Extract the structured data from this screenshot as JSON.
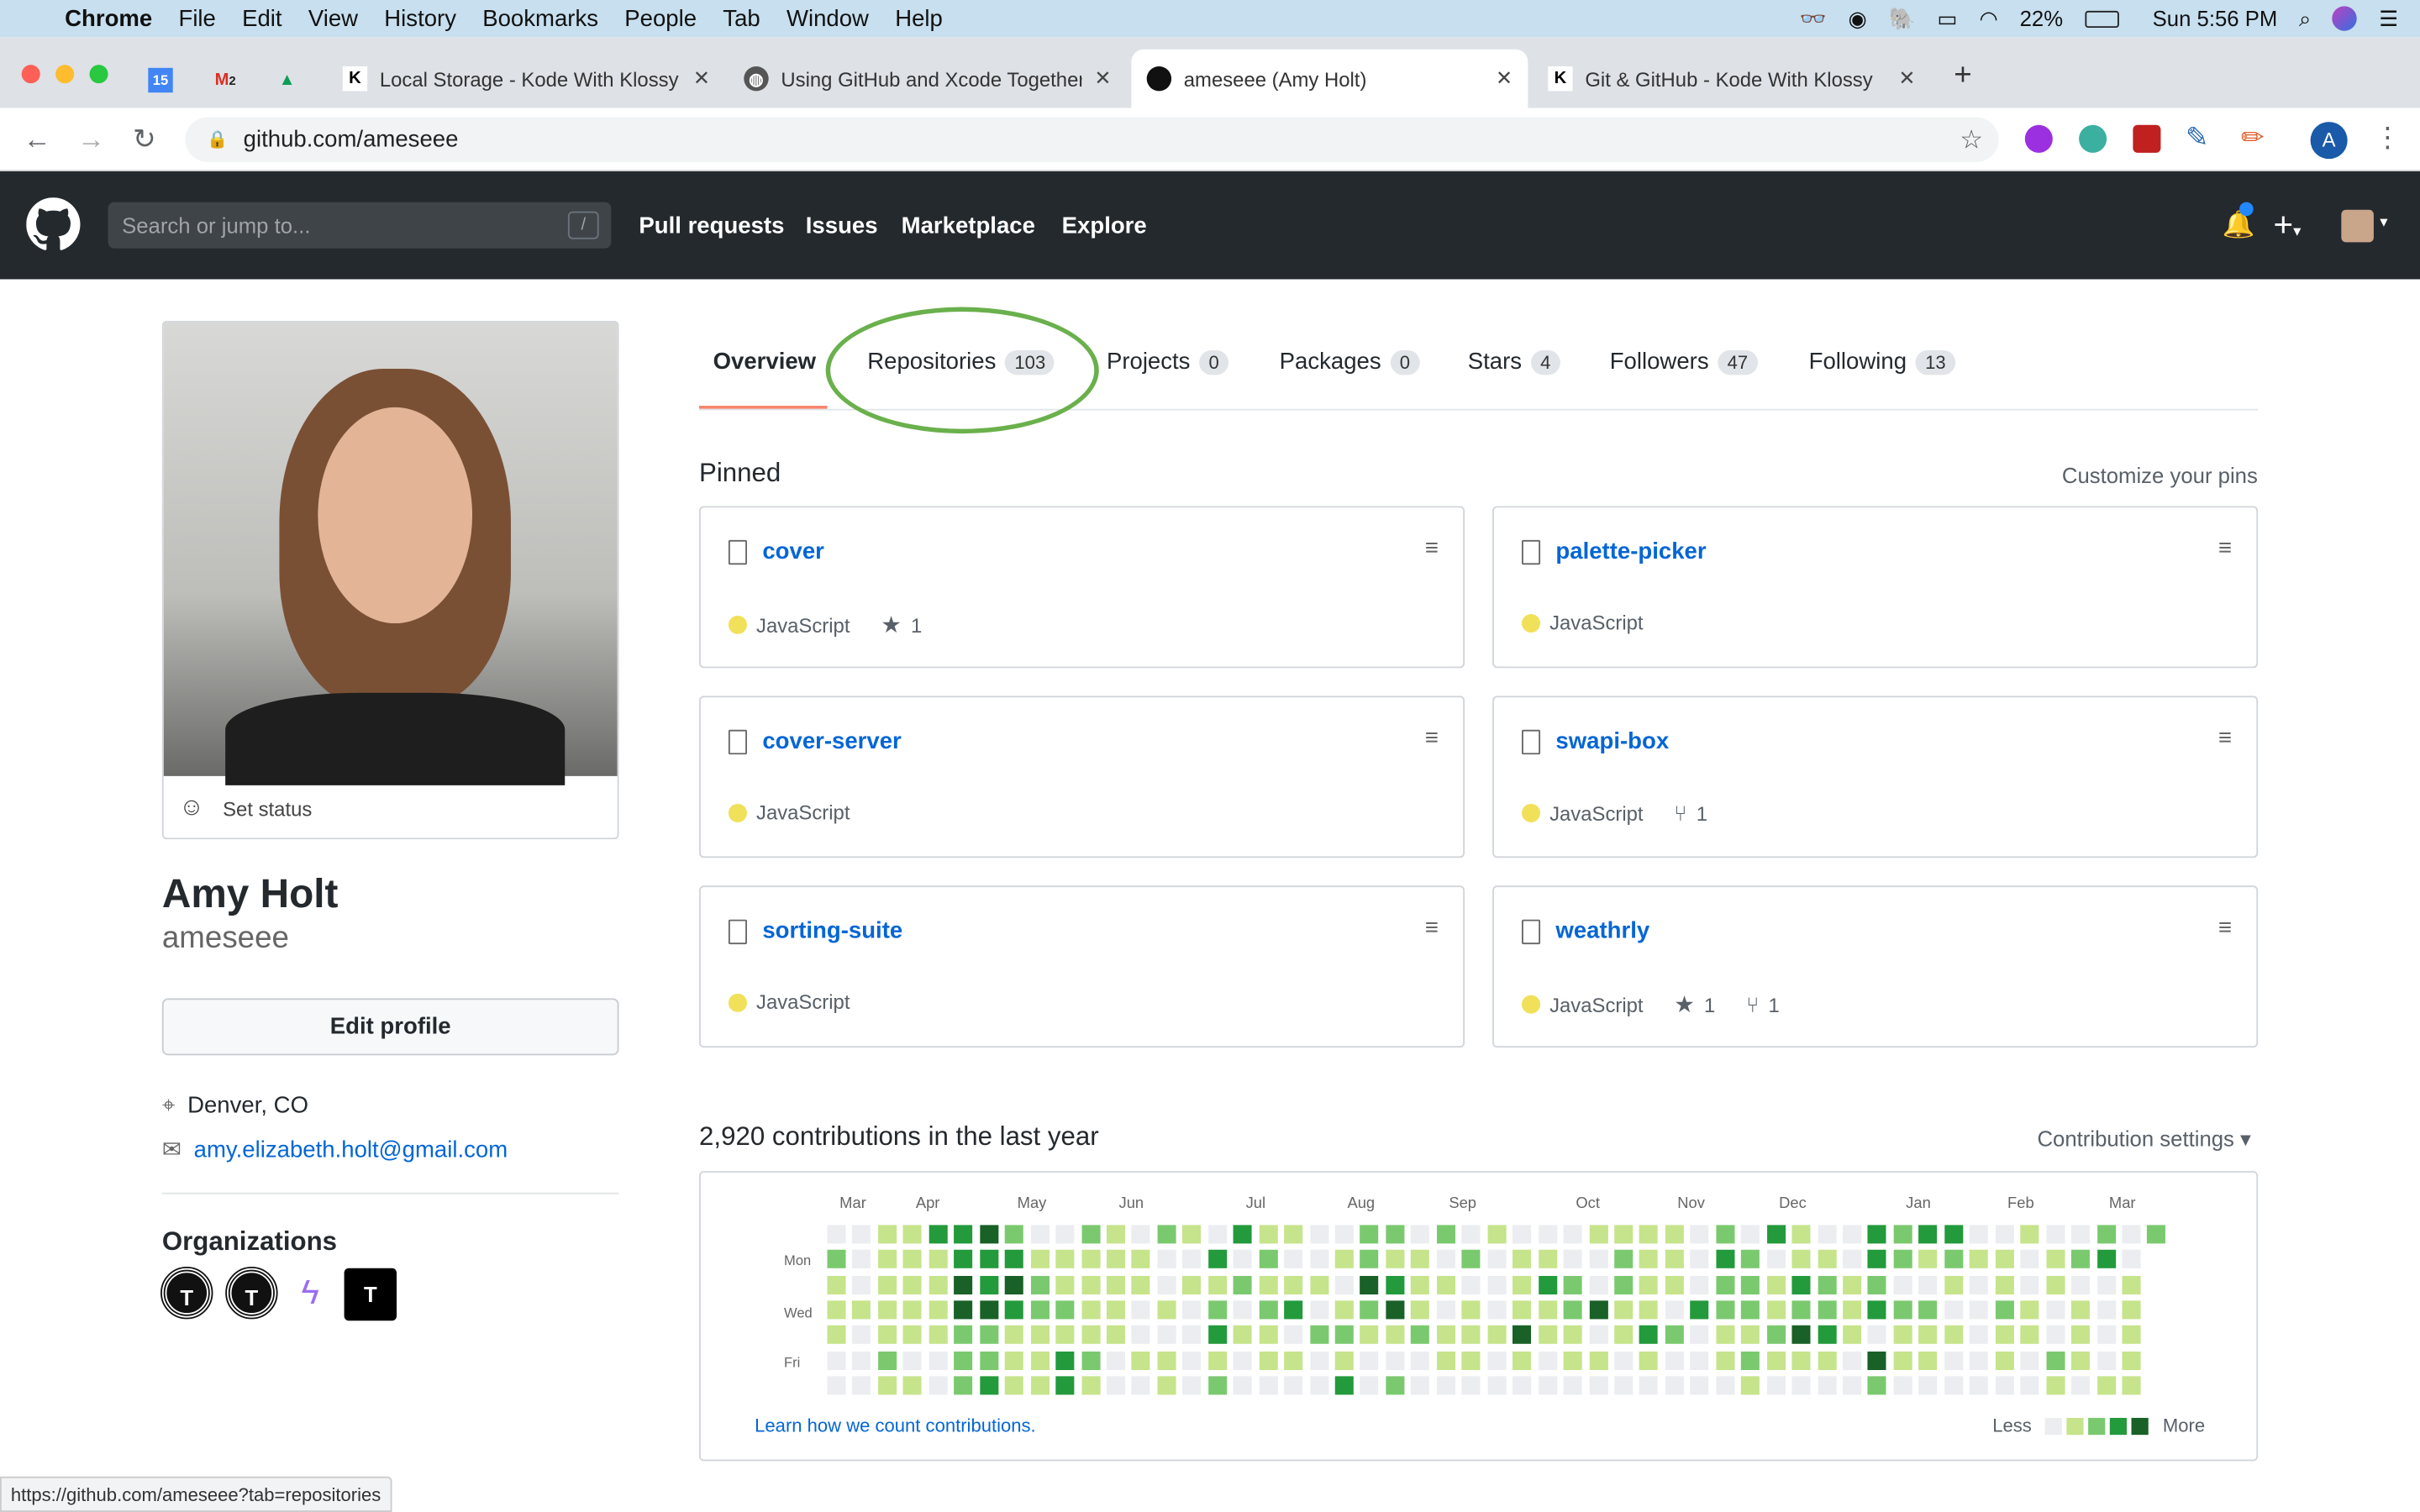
{
  "menubar": {
    "app": "Chrome",
    "items": [
      "File",
      "Edit",
      "View",
      "History",
      "Bookmarks",
      "People",
      "Tab",
      "Window",
      "Help"
    ],
    "battery": "22%",
    "clock": "Sun 5:56 PM"
  },
  "tabs": [
    {
      "title": "Local Storage - Kode With Klossy",
      "favicon": "K"
    },
    {
      "title": "Using GitHub and Xcode Together",
      "favicon": "globe"
    },
    {
      "title": "ameseee (Amy Holt)",
      "favicon": "github",
      "active": true
    },
    {
      "title": "Git & GitHub - Kode With Klossy",
      "favicon": "K"
    }
  ],
  "pinned_tab_badges": {
    "calendar": "15",
    "gmail": "2"
  },
  "address": {
    "url": "github.com/ameseee",
    "profile_initial": "A"
  },
  "github_header": {
    "search_placeholder": "Search or jump to...",
    "slash": "/",
    "nav": [
      "Pull requests",
      "Issues",
      "Marketplace",
      "Explore"
    ]
  },
  "profile": {
    "set_status": "Set status",
    "name": "Amy Holt",
    "login": "ameseee",
    "edit_profile": "Edit profile",
    "location": "Denver, CO",
    "email": "amy.elizabeth.holt@gmail.com",
    "organizations_title": "Organizations",
    "orgs": [
      "T",
      "T",
      "bolt",
      "T"
    ]
  },
  "profile_tabs": [
    {
      "label": "Overview",
      "count": null,
      "selected": true
    },
    {
      "label": "Repositories",
      "count": "103",
      "highlighted": true
    },
    {
      "label": "Projects",
      "count": "0"
    },
    {
      "label": "Packages",
      "count": "0"
    },
    {
      "label": "Stars",
      "count": "4"
    },
    {
      "label": "Followers",
      "count": "47"
    },
    {
      "label": "Following",
      "count": "13"
    }
  ],
  "pinned": {
    "title": "Pinned",
    "customize": "Customize your pins",
    "repos": [
      {
        "name": "cover",
        "language": "JavaScript",
        "stars": "1",
        "forks": null
      },
      {
        "name": "palette-picker",
        "language": "JavaScript",
        "stars": null,
        "forks": null
      },
      {
        "name": "cover-server",
        "language": "JavaScript",
        "stars": null,
        "forks": null
      },
      {
        "name": "swapi-box",
        "language": "JavaScript",
        "stars": null,
        "forks": "1"
      },
      {
        "name": "sorting-suite",
        "language": "JavaScript",
        "stars": null,
        "forks": null
      },
      {
        "name": "weathrly",
        "language": "JavaScript",
        "stars": "1",
        "forks": "1"
      }
    ]
  },
  "contributions": {
    "heading": "2,920 contributions in the last year",
    "settings": "Contribution settings ▾",
    "months": [
      "Mar",
      "Apr",
      "May",
      "Jun",
      "Jul",
      "Aug",
      "Sep",
      "Oct",
      "Nov",
      "Dec",
      "Jan",
      "Feb",
      "Mar"
    ],
    "days": [
      "Mon",
      "Wed",
      "Fri"
    ],
    "learn": "Learn how we count contributions.",
    "less": "Less",
    "more": "More",
    "colors": [
      "#ebedf0",
      "#c6e48b",
      "#7bc96f",
      "#239a3b",
      "#196127"
    ],
    "levels": [
      [
        0,
        0,
        1,
        1,
        3,
        3,
        4,
        2,
        0,
        0,
        2,
        1,
        0,
        2,
        1,
        0,
        3,
        1,
        1,
        0,
        0,
        2,
        2,
        0,
        2,
        0,
        1,
        0,
        0,
        0,
        1,
        1,
        1,
        1,
        0,
        2,
        0,
        3,
        1,
        0,
        0,
        3,
        2,
        3,
        3,
        0,
        0,
        1,
        0,
        0,
        2,
        0,
        2
      ],
      [
        2,
        0,
        1,
        1,
        1,
        3,
        3,
        3,
        1,
        1,
        1,
        1,
        1,
        0,
        0,
        3,
        0,
        2,
        0,
        0,
        1,
        2,
        1,
        1,
        0,
        2,
        0,
        1,
        1,
        0,
        0,
        2,
        1,
        1,
        0,
        3,
        2,
        0,
        1,
        1,
        0,
        3,
        2,
        1,
        2,
        1,
        1,
        0,
        1,
        2,
        3,
        0
      ],
      [
        1,
        0,
        1,
        1,
        1,
        4,
        3,
        4,
        2,
        1,
        1,
        1,
        1,
        0,
        1,
        1,
        2,
        1,
        1,
        1,
        0,
        4,
        3,
        1,
        1,
        0,
        0,
        1,
        3,
        2,
        0,
        2,
        1,
        1,
        0,
        2,
        2,
        1,
        3,
        2,
        1,
        2,
        0,
        0,
        1,
        0,
        1,
        0,
        1,
        0,
        0,
        1
      ],
      [
        1,
        1,
        1,
        1,
        1,
        4,
        4,
        3,
        2,
        2,
        1,
        1,
        0,
        1,
        0,
        2,
        0,
        2,
        3,
        0,
        1,
        2,
        4,
        1,
        0,
        1,
        0,
        1,
        1,
        2,
        4,
        1,
        1,
        0,
        3,
        2,
        2,
        1,
        2,
        2,
        1,
        3,
        2,
        2,
        0,
        0,
        2,
        1,
        0,
        1,
        0,
        1
      ],
      [
        1,
        0,
        1,
        1,
        1,
        2,
        2,
        1,
        1,
        1,
        1,
        1,
        0,
        0,
        0,
        3,
        1,
        1,
        0,
        2,
        2,
        1,
        1,
        2,
        1,
        1,
        1,
        4,
        1,
        1,
        0,
        1,
        3,
        2,
        0,
        1,
        1,
        2,
        4,
        3,
        1,
        0,
        1,
        1,
        1,
        0,
        1,
        1,
        0,
        1,
        0,
        1
      ],
      [
        0,
        0,
        2,
        0,
        0,
        2,
        2,
        1,
        1,
        3,
        2,
        0,
        1,
        1,
        0,
        1,
        0,
        1,
        1,
        0,
        1,
        0,
        0,
        0,
        1,
        1,
        0,
        1,
        0,
        1,
        1,
        0,
        1,
        0,
        0,
        1,
        2,
        1,
        1,
        1,
        0,
        4,
        1,
        1,
        0,
        0,
        1,
        0,
        2,
        1,
        0,
        1
      ],
      [
        0,
        0,
        1,
        1,
        0,
        2,
        3,
        1,
        1,
        3,
        1,
        0,
        0,
        1,
        0,
        2,
        0,
        0,
        0,
        0,
        3,
        0,
        2,
        0,
        0,
        0,
        0,
        0,
        0,
        0,
        0,
        0,
        0,
        0,
        0,
        0,
        1,
        0,
        0,
        0,
        0,
        2,
        0,
        0,
        0,
        0,
        0,
        0,
        1,
        0,
        1,
        1
      ]
    ]
  },
  "status_bar": {
    "url": "https://github.com/ameseee?tab=repositories"
  },
  "colors": {
    "link": "#0366d6",
    "header": "#24292e",
    "tab_underline": "#f9826c",
    "highlight_circle": "#6ab04c"
  }
}
